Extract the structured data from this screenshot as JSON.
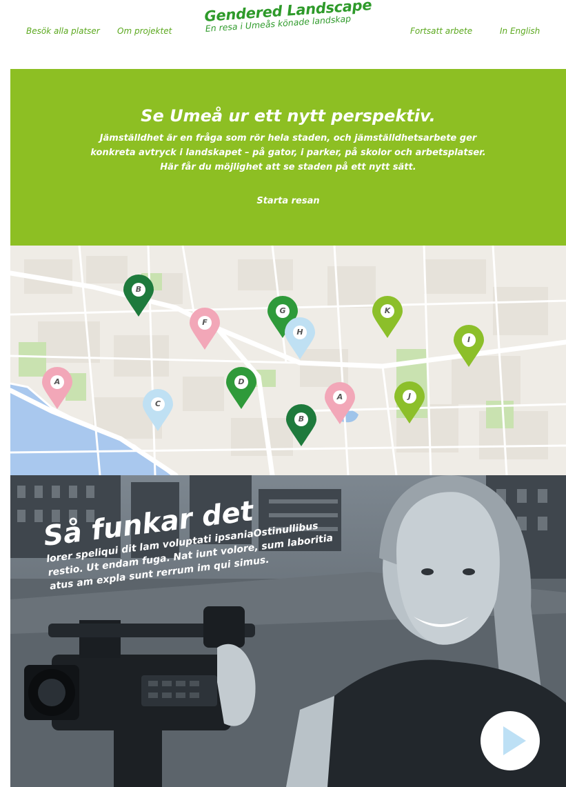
{
  "header": {
    "nav_left": [
      "Besök alla platser",
      "Om projektet"
    ],
    "logo_title": "Gendered Landscape",
    "logo_subtitle": "En resa i Umeås könade landskap",
    "nav_right": [
      "Fortsatt arbete",
      "In English"
    ]
  },
  "hero": {
    "title": "Se Umeå ur ett nytt perspektiv.",
    "text_lines": [
      "Jämställdhet är en fråga som rör hela staden, och jämställdhetsarbete ger",
      "konkreta avtryck i landskapet – på gator, i parker, på skolor och arbetsplatser.",
      "Här får du möjlighet att se staden på ett nytt sätt."
    ],
    "cta_label": "Starta resan",
    "background_color": "#8dbf23"
  },
  "map": {
    "pins": [
      {
        "letter": "B",
        "color": "#1e7a3c"
      },
      {
        "letter": "F",
        "color": "#f2a7b8"
      },
      {
        "letter": "G",
        "color": "#2f9a3a"
      },
      {
        "letter": "H",
        "color": "#bfe0f3"
      },
      {
        "letter": "K",
        "color": "#8cbf2a"
      },
      {
        "letter": "I",
        "color": "#8cbf2a"
      },
      {
        "letter": "A",
        "color": "#f2a7b8"
      },
      {
        "letter": "D",
        "color": "#2f9a3a"
      },
      {
        "letter": "C",
        "color": "#bfe0f3"
      },
      {
        "letter": "A",
        "color": "#f2a7b8"
      },
      {
        "letter": "J",
        "color": "#8cbf2a"
      },
      {
        "letter": "B",
        "color": "#1e7a3c"
      }
    ]
  },
  "video": {
    "title": "Så funkar det",
    "body_lines": [
      "lorer speliqui dit lam voluptati ipsaniaOstinullibus",
      "restio. Ut endam fuga. Nat iunt volore, sum laboritia",
      "atus am expla sunt rerrum im qui simus."
    ],
    "play_icon": "play-icon"
  }
}
